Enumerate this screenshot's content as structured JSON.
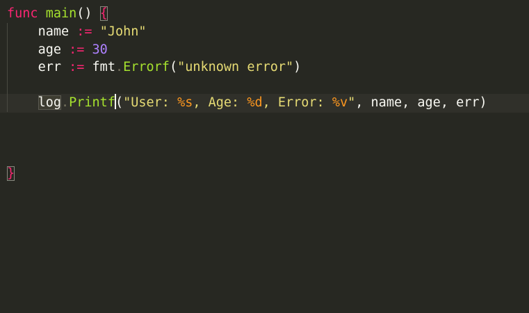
{
  "editor": {
    "line1": {
      "kw": "func",
      "name": "main",
      "parens": "()",
      "brace": "{"
    },
    "line2": {
      "ident": "name",
      "op": ":=",
      "str": "\"John\""
    },
    "line3": {
      "ident": "age",
      "op": ":=",
      "num": "30"
    },
    "line4": {
      "ident": "err",
      "op": ":=",
      "pkg": "fmt",
      "fn": "Errorf",
      "str": "\"unknown error\""
    },
    "line6": {
      "pkg": "log",
      "fn": "Printf",
      "str_a": "\"User: ",
      "fmt_s": "%s",
      "str_b": ", Age: ",
      "fmt_d": "%d",
      "str_c": ", Error: ",
      "fmt_v": "%v",
      "str_d": "\"",
      "arg1": "name",
      "arg2": "age",
      "arg3": "err"
    },
    "line10": {
      "brace": "}"
    }
  },
  "colors": {
    "background": "#272822",
    "keyword": "#F92672",
    "function": "#A6E22E",
    "string": "#E6DB74",
    "number": "#AE81FF",
    "format_verb": "#FD971F",
    "text": "#F8F8F2"
  }
}
